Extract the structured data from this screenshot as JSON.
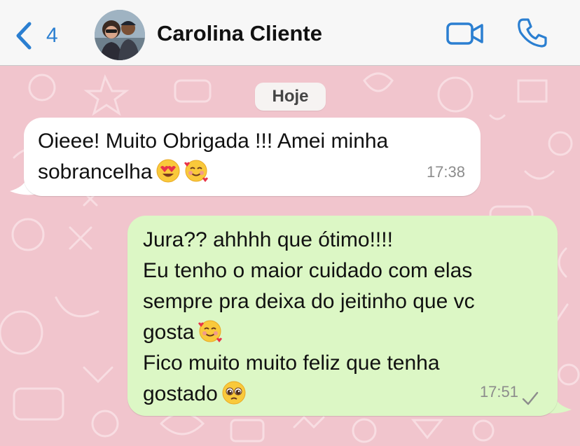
{
  "header": {
    "back_count": "4",
    "contact_name": "Carolina Cliente"
  },
  "chat": {
    "date_label": "Hoje",
    "messages": [
      {
        "direction": "incoming",
        "lines": [
          "Oieee! Muito Obrigada !!! Amei minha",
          "sobrancelha"
        ],
        "emojis": [
          "heart-eyes-emoji",
          "smiling-face-with-hearts-emoji"
        ],
        "time": "17:38"
      },
      {
        "direction": "outgoing",
        "lines": [
          "Jura?? ahhhh que ótimo!!!!",
          "Eu tenho o maior cuidado com elas",
          "sempre pra deixa do jeitinho que vc",
          "gosta",
          "Fico muito muito feliz que tenha",
          "gostado"
        ],
        "emojis": [
          "smiling-face-with-hearts-emoji",
          "pleading-face-emoji"
        ],
        "time": "17:51",
        "status": "sent-check"
      }
    ]
  },
  "colors": {
    "accent": "#2b7fd1",
    "wallpaper": "#f1c5cd",
    "outgoing_bubble": "#dcf7c5",
    "incoming_bubble": "#ffffff"
  }
}
